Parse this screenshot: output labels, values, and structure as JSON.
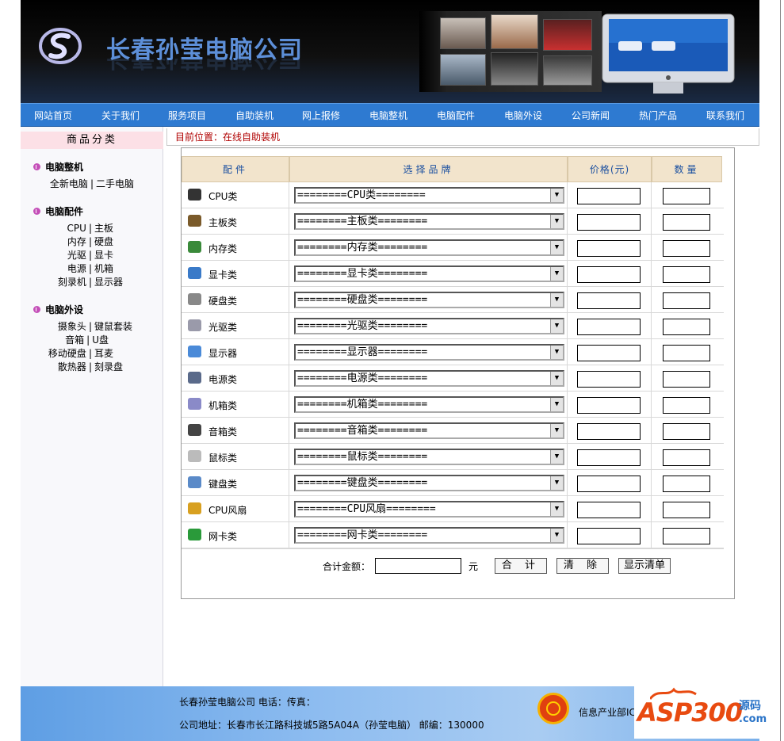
{
  "header": {
    "site_title": "长春孙莹电脑公司"
  },
  "nav": {
    "items": [
      "网站首页",
      "关于我们",
      "服务项目",
      "自助装机",
      "网上报修",
      "电脑整机",
      "电脑配件",
      "电脑外设",
      "公司新闻",
      "热门产品",
      "联系我们"
    ]
  },
  "sidebar": {
    "header": "商品分类",
    "sections": [
      {
        "title": "电脑整机",
        "rows": [
          [
            "全新电脑",
            "二手电脑"
          ]
        ]
      },
      {
        "title": "电脑配件",
        "rows": [
          [
            "CPU",
            "主板"
          ],
          [
            "内存",
            "硬盘"
          ],
          [
            "光驱",
            "显卡"
          ],
          [
            "电源",
            "机箱"
          ],
          [
            "刻录机",
            "显示器"
          ]
        ]
      },
      {
        "title": "电脑外设",
        "rows": [
          [
            "摄象头",
            "键鼠套装"
          ],
          [
            "音箱",
            "U盘"
          ],
          [
            "移动硬盘",
            "耳麦"
          ],
          [
            "散热器",
            "刻录盘"
          ]
        ]
      }
    ]
  },
  "breadcrumb": "目前位置：在线自助装机",
  "table": {
    "headers": {
      "part": "配件",
      "brand": "选择品牌",
      "price": "价格(元)",
      "qty": "数量"
    },
    "rows": [
      {
        "icon": "cpu-icon",
        "label": "CPU类",
        "select": "========CPU类========",
        "color": "#333"
      },
      {
        "icon": "motherboard-icon",
        "label": "主板类",
        "select": "========主板类========",
        "color": "#7a5a2a"
      },
      {
        "icon": "memory-icon",
        "label": "内存类",
        "select": "========内存类========",
        "color": "#3a8a3a"
      },
      {
        "icon": "graphics-card-icon",
        "label": "显卡类",
        "select": "========显卡类========",
        "color": "#3a7ac8"
      },
      {
        "icon": "hard-disk-icon",
        "label": "硬盘类",
        "select": "========硬盘类========",
        "color": "#888"
      },
      {
        "icon": "optical-drive-icon",
        "label": "光驱类",
        "select": "========光驱类========",
        "color": "#9a9aaa"
      },
      {
        "icon": "monitor-icon",
        "label": "显示器",
        "select": "========显示器========",
        "color": "#4a8ad8"
      },
      {
        "icon": "power-supply-icon",
        "label": "电源类",
        "select": "========电源类========",
        "color": "#5a6a8a"
      },
      {
        "icon": "case-icon",
        "label": "机箱类",
        "select": "========机箱类========",
        "color": "#8a8ac8"
      },
      {
        "icon": "speaker-icon",
        "label": "音箱类",
        "select": "========音箱类========",
        "color": "#444"
      },
      {
        "icon": "mouse-icon",
        "label": "鼠标类",
        "select": "========鼠标类========",
        "color": "#bbb"
      },
      {
        "icon": "keyboard-icon",
        "label": "键盘类",
        "select": "========键盘类========",
        "color": "#5a8ac8"
      },
      {
        "icon": "cpu-fan-icon",
        "label": "CPU风扇",
        "select": "========CPU风扇========",
        "color": "#d8a020"
      },
      {
        "icon": "network-card-icon",
        "label": "网卡类",
        "select": "========网卡类========",
        "color": "#2a9a3a"
      }
    ]
  },
  "totals": {
    "label": "合计金额：",
    "unit": "元",
    "sum_button": "合 计",
    "clear_button": "清 除",
    "list_button": "显示清单"
  },
  "footer": {
    "line1": "长春孙莹电脑公司 电话：传真：",
    "line2": "公司地址：长春市长江路科技城5路5A04A（孙莹电脑） 邮编：130000",
    "icp": "信息产业部IC",
    "watermark": "ASP300",
    "watermark_cn": "源码",
    "watermark_com": ".com"
  },
  "colors": {
    "nav_bg": "#2e7ad1",
    "breadcrumb": "#b00000",
    "table_header_bg": "#f2e4cc",
    "table_header_text": "#1a4fa0"
  }
}
